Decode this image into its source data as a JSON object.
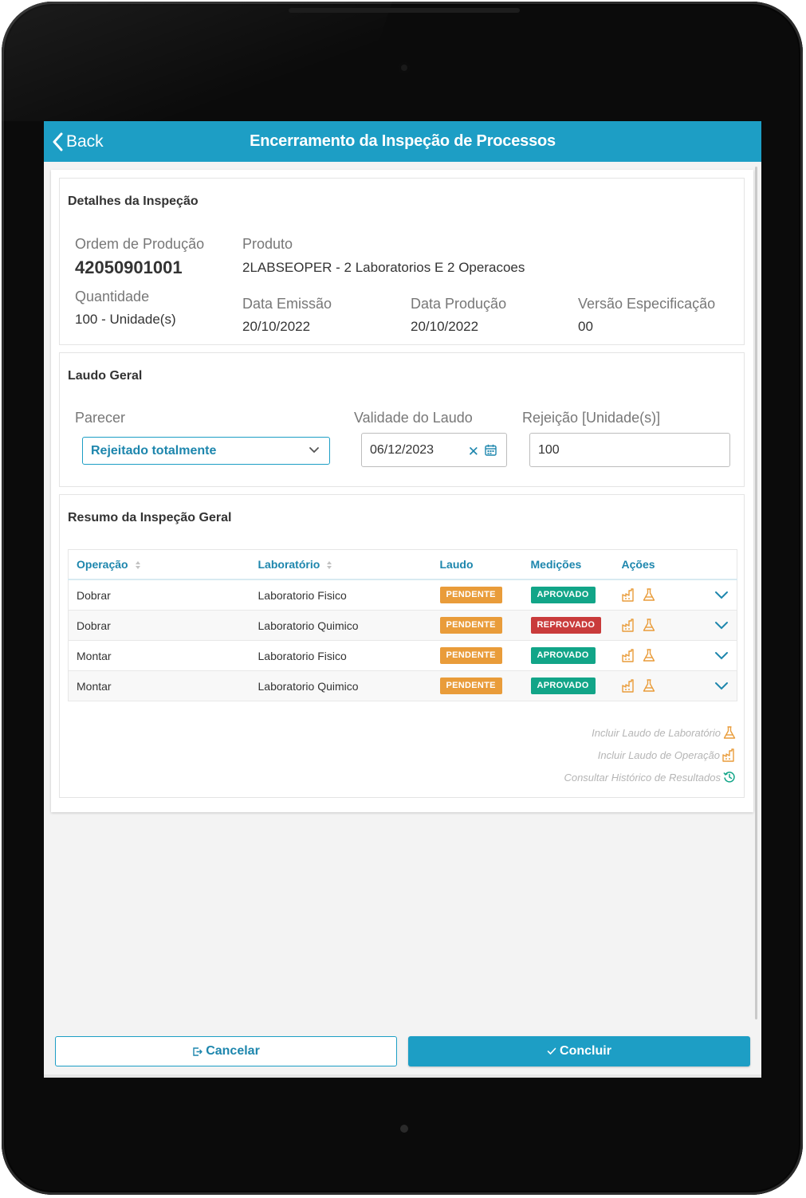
{
  "header": {
    "back_label": "Back",
    "title": "Encerramento da Inspeção de Processos"
  },
  "detalhes": {
    "title": "Detalhes da Inspeção",
    "ordem_label": "Ordem de Produção",
    "ordem_value": "42050901001",
    "produto_label": "Produto",
    "produto_value": "2LABSEOPER - 2 Laboratorios E 2 Operacoes",
    "quantidade_label": "Quantidade",
    "quantidade_value": "100 - Unidade(s)",
    "emissao_label": "Data Emissão",
    "emissao_value": "20/10/2022",
    "producao_label": "Data Produção",
    "producao_value": "20/10/2022",
    "versao_label": "Versão Especificação",
    "versao_value": "00"
  },
  "laudo": {
    "title": "Laudo Geral",
    "parecer_label": "Parecer",
    "parecer_value": "Rejeitado totalmente",
    "validade_label": "Validade do Laudo",
    "validade_value": "06/12/2023",
    "rejeicao_label": "Rejeição [Unidade(s)]",
    "rejeicao_value": "100"
  },
  "resumo": {
    "title": "Resumo da Inspeção Geral",
    "columns": {
      "operacao": "Operação",
      "laboratorio": "Laboratório",
      "laudo": "Laudo",
      "medicoes": "Medições",
      "acoes": "Ações"
    },
    "rows": [
      {
        "operacao": "Dobrar",
        "laboratorio": "Laboratorio Fisico",
        "laudo": "PENDENTE",
        "medicoes": "APROVADO"
      },
      {
        "operacao": "Dobrar",
        "laboratorio": "Laboratorio Quimico",
        "laudo": "PENDENTE",
        "medicoes": "REPROVADO"
      },
      {
        "operacao": "Montar",
        "laboratorio": "Laboratorio Fisico",
        "laudo": "PENDENTE",
        "medicoes": "APROVADO"
      },
      {
        "operacao": "Montar",
        "laboratorio": "Laboratorio Quimico",
        "laudo": "PENDENTE",
        "medicoes": "APROVADO"
      }
    ],
    "links": {
      "incluir_lab": "Incluir Laudo de Laboratório",
      "incluir_op": "Incluir Laudo de Operação",
      "consultar": "Consultar Histórico de Resultados"
    }
  },
  "footer": {
    "cancel_label": "Cancelar",
    "confirm_label": "Concluir"
  },
  "colors": {
    "primary": "#1d9ec5",
    "pending": "#e99c3a",
    "approved": "#12a588",
    "rejected": "#c93b3b",
    "action_icon": "#e99c3a",
    "history_icon": "#12a588"
  },
  "icons": {
    "back": "chevron-left-icon",
    "dropdown": "chevron-down-icon",
    "clear": "close-icon",
    "calendar": "calendar-icon",
    "sort": "sort-icon",
    "factory": "factory-icon",
    "flask": "flask-icon",
    "expand": "chevron-down-icon",
    "history": "history-icon",
    "cancel": "exit-icon",
    "confirm": "check-icon"
  }
}
